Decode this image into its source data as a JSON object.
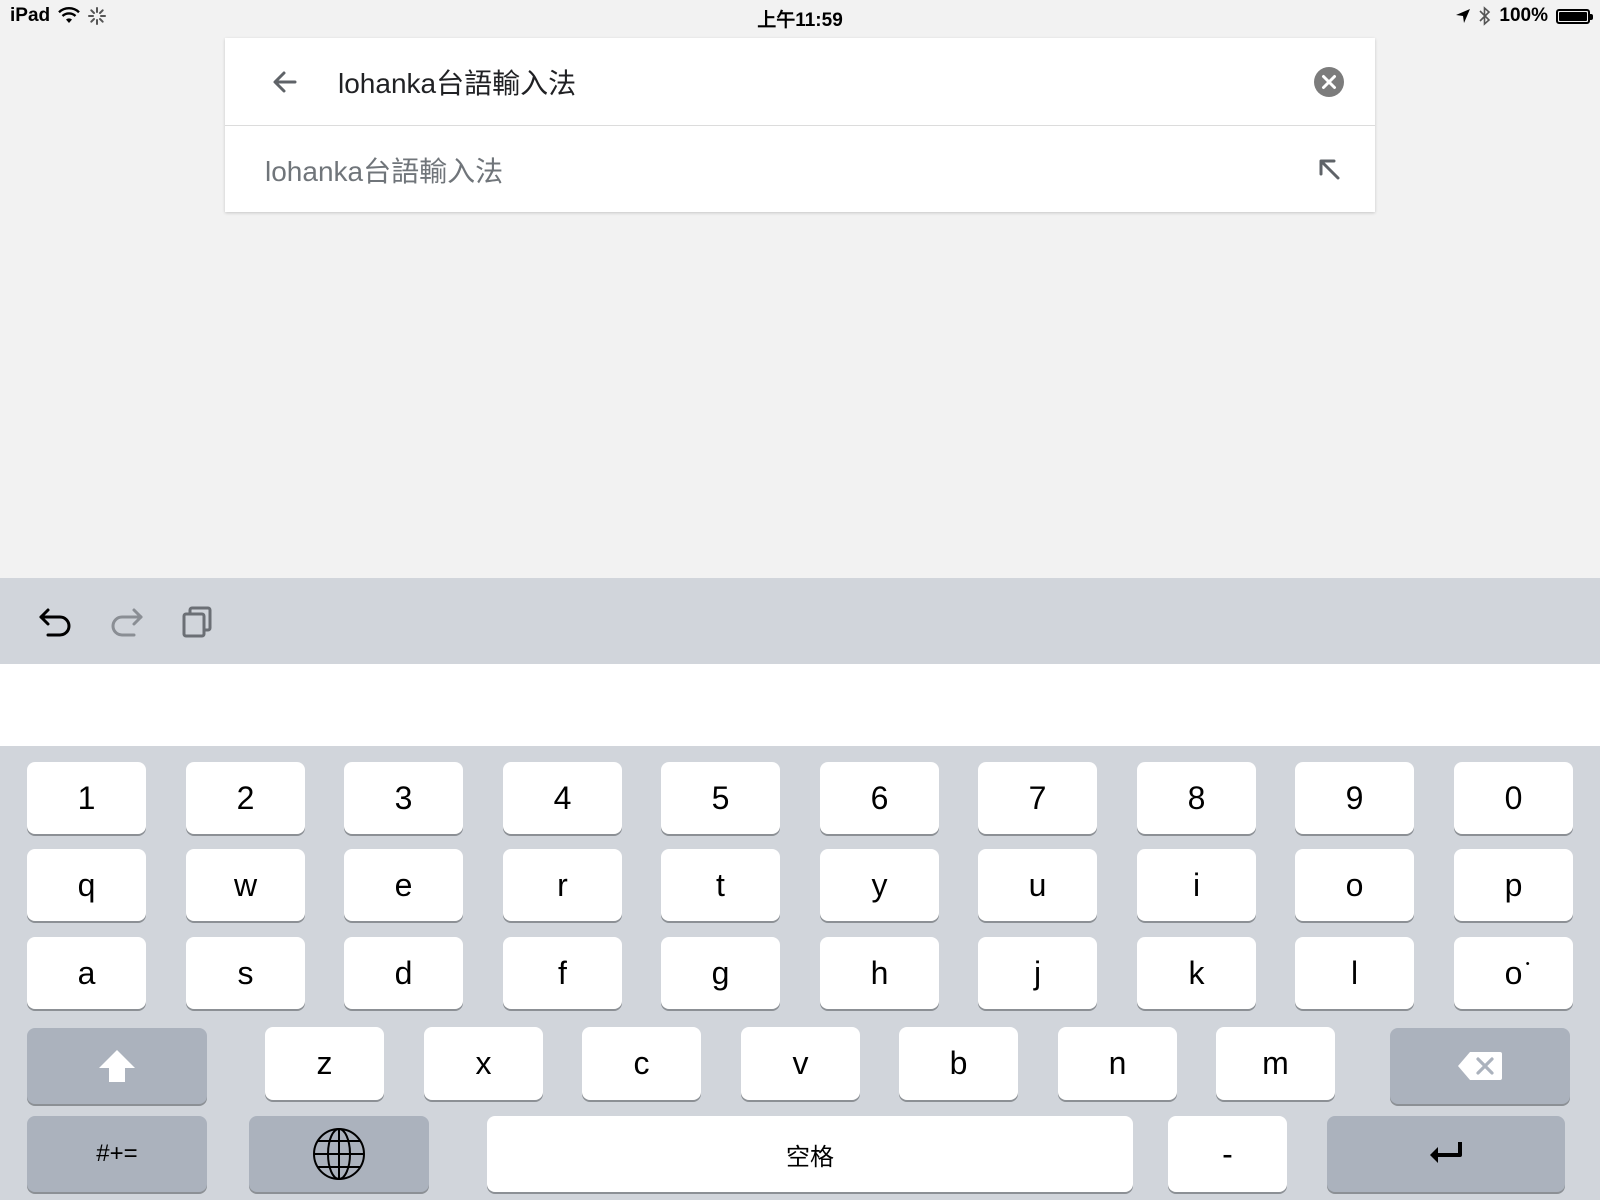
{
  "status_bar": {
    "device": "iPad",
    "time": "上午11:59",
    "battery_text": "100%",
    "battery_level": 1.0,
    "icons": [
      "wifi-icon",
      "activity-spinner-icon",
      "location-arrow-icon",
      "bluetooth-icon",
      "battery-icon"
    ]
  },
  "search": {
    "query": "lohanka台語輸入法",
    "suggestions": [
      {
        "text": "lohanka台語輸入法"
      }
    ]
  },
  "keyboard": {
    "toolbar_icons": [
      "undo-icon",
      "redo-icon",
      "clipboard-icon"
    ],
    "rows": [
      [
        "1",
        "2",
        "3",
        "4",
        "5",
        "6",
        "7",
        "8",
        "9",
        "0"
      ],
      [
        "q",
        "w",
        "e",
        "r",
        "t",
        "y",
        "u",
        "i",
        "o",
        "p"
      ],
      [
        "a",
        "s",
        "d",
        "f",
        "g",
        "h",
        "j",
        "k",
        "l",
        "o͘"
      ],
      [
        "z",
        "x",
        "c",
        "v",
        "b",
        "n",
        "m"
      ]
    ],
    "symbols_label": "#+=",
    "space_label": "空格",
    "dash_label": "-",
    "colors": {
      "key": "#ffffff",
      "dark_key": "#abb2bd",
      "background": "#d1d5db"
    }
  }
}
